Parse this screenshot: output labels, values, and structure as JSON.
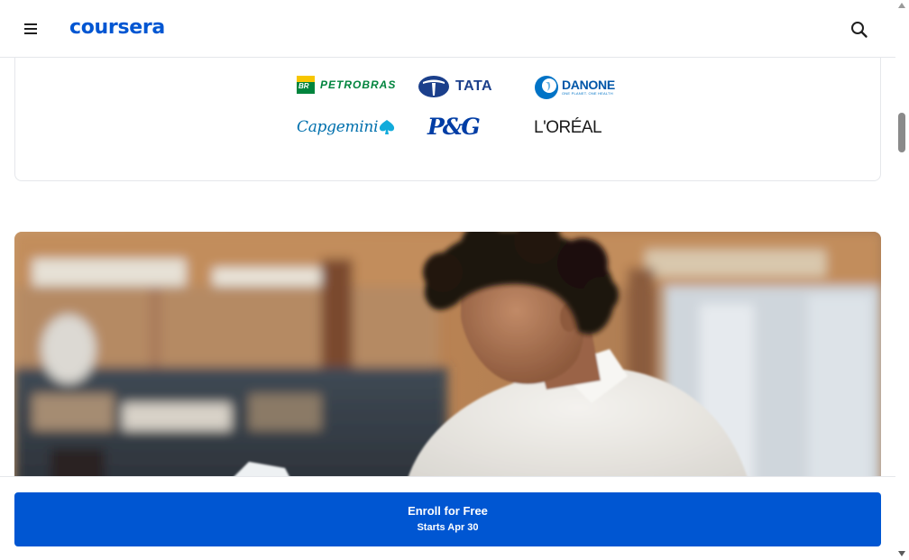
{
  "header": {
    "logo_text": "coursera",
    "menu_icon": "hamburger-menu-icon",
    "search_icon": "search-icon"
  },
  "partners": [
    {
      "name": "PETROBRAS",
      "badge": "BR"
    },
    {
      "name": "TATA"
    },
    {
      "name": "DANONE",
      "tagline": "ONE PLANET. ONE HEALTH"
    },
    {
      "name": "Capgemini"
    },
    {
      "name": "P&G"
    },
    {
      "name": "L'ORÉAL"
    }
  ],
  "hero": {
    "image_icon": "student-studying-photo"
  },
  "cta": {
    "label": "Enroll for Free",
    "sublabel": "Starts Apr 30"
  },
  "colors": {
    "brand": "#0056d2",
    "border": "#e5e7eb"
  }
}
